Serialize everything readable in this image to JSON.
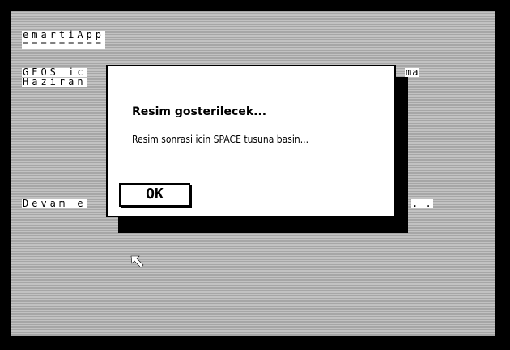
{
  "background": {
    "title": "emartiApp",
    "title_underline": "=========",
    "line1_left": "GEOS ic",
    "line2_left": "Haziran",
    "line_bottom_left": "Devam e",
    "right_fragment_1": "ma",
    "right_fragment_2": ". ."
  },
  "dialog": {
    "title": "Resim gosterilecek...",
    "message": "Resim sonrasi icin SPACE tusuna basin...",
    "ok_label": "OK"
  },
  "icons": {
    "pointer": "arrow-pointer-icon"
  },
  "colors": {
    "screen": "#b4b4b4",
    "dialog": "#ffffff",
    "shadow": "#000000"
  }
}
